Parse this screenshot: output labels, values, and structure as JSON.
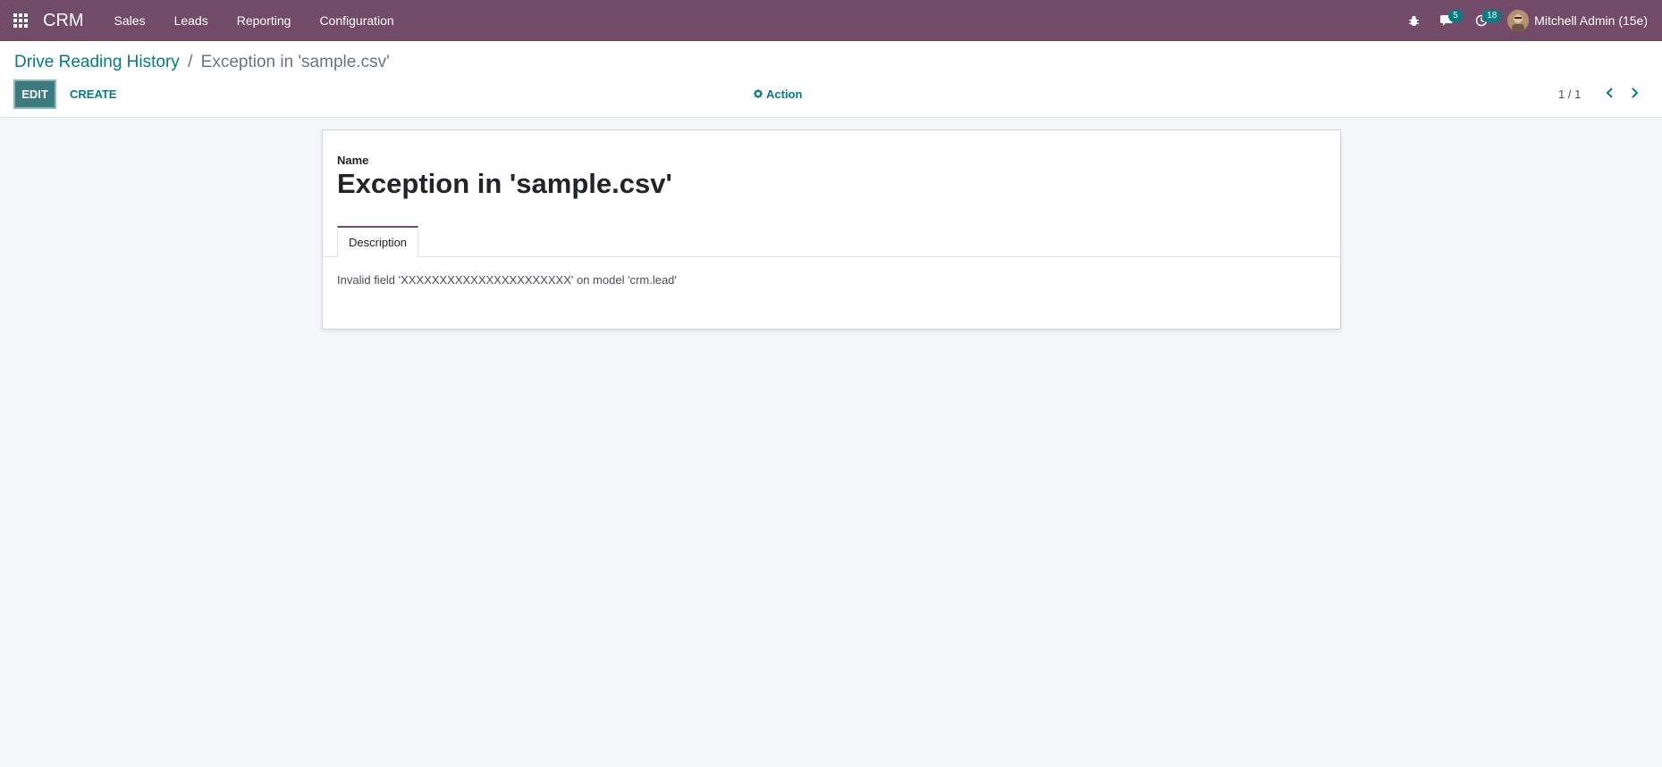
{
  "navbar": {
    "app_name": "CRM",
    "menu": [
      "Sales",
      "Leads",
      "Reporting",
      "Configuration"
    ],
    "messages_count": "5",
    "activities_count": "18",
    "user_name": "Mitchell Admin (15e)"
  },
  "breadcrumb": {
    "parent": "Drive Reading History",
    "separator": "/",
    "current": "Exception in 'sample.csv'"
  },
  "toolbar": {
    "edit_label": "EDIT",
    "create_label": "CREATE",
    "action_label": "Action"
  },
  "pager": {
    "value": "1 / 1"
  },
  "form": {
    "name_label": "Name",
    "name_value": "Exception in 'sample.csv'",
    "tabs": [
      {
        "label": "Description"
      }
    ],
    "description": "Invalid field 'XXXXXXXXXXXXXXXXXXXXXX' on model 'crm.lead'"
  },
  "colors": {
    "brand": "#714b67",
    "accent": "#017e84"
  },
  "icons": [
    "apps-grid-icon",
    "bug-icon",
    "chat-icon",
    "activity-clock-icon",
    "gear-icon",
    "chevron-left-icon",
    "chevron-right-icon"
  ]
}
